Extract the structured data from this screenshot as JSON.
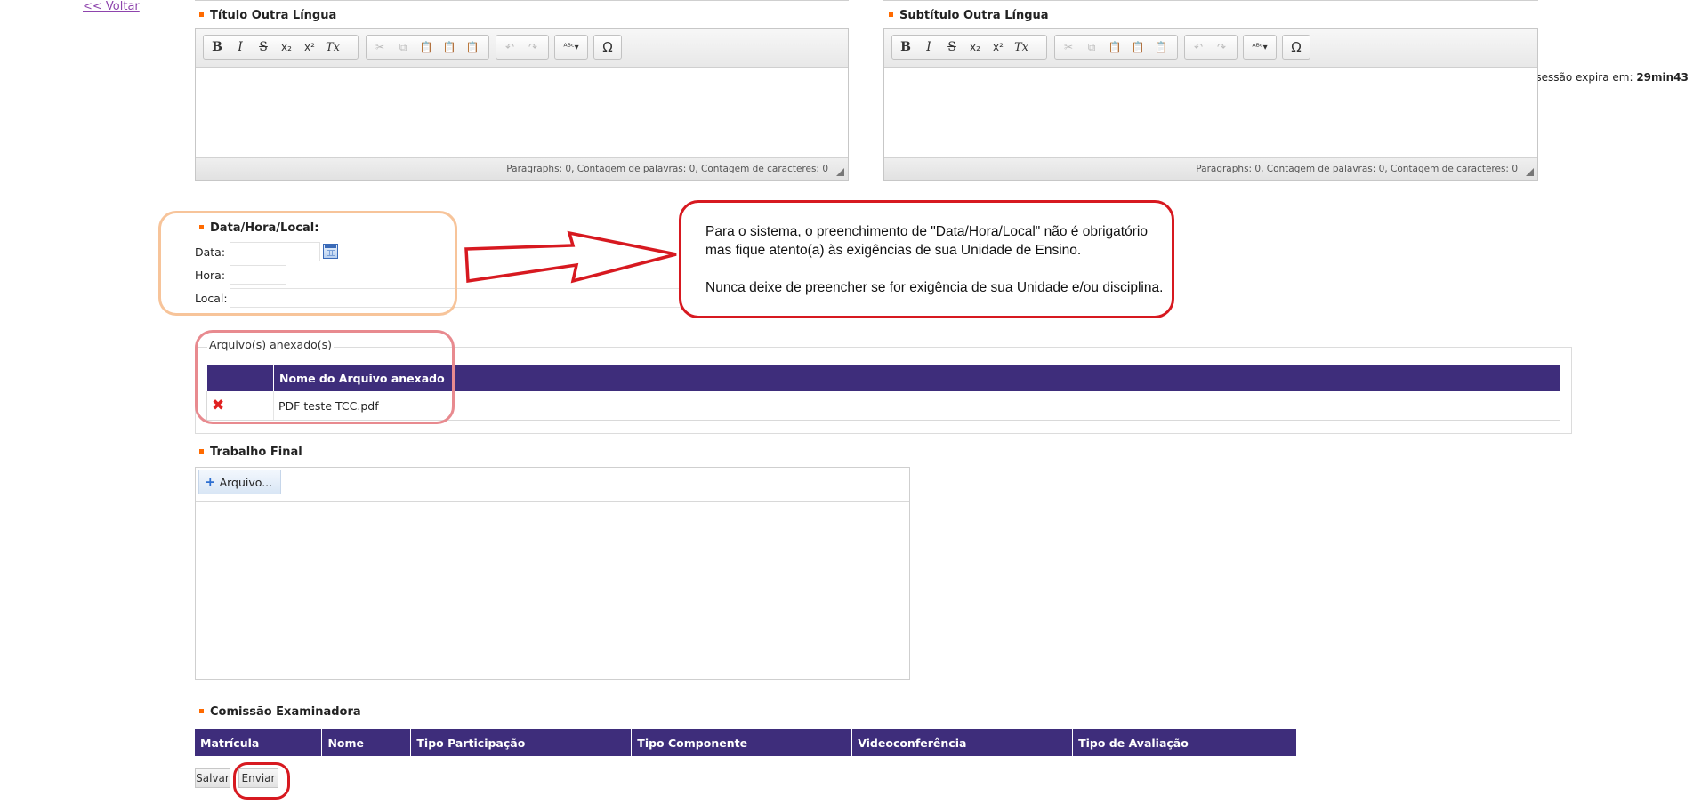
{
  "nav": {
    "back_link": "<< Voltar"
  },
  "session": {
    "label": "Sua sessão expira em:",
    "time": "29min43"
  },
  "editors": {
    "titulo": {
      "title": "Título Outra Língua",
      "status": "Paragraphs: 0, Contagem de palavras: 0, Contagem de caracteres: 0"
    },
    "subtitulo": {
      "title": "Subtítulo Outra Língua",
      "status": "Paragraphs: 0, Contagem de palavras: 0, Contagem de caracteres: 0"
    }
  },
  "toolbar_glyphs": {
    "bold": "B",
    "italic": "I",
    "strike": "S",
    "subscript": "x₂",
    "superscript": "x²",
    "remove_format": "Tx",
    "cut": "✂",
    "copy": "⧉",
    "paste": "📋",
    "paste_text": "📋",
    "paste_word": "📋",
    "undo": "↶",
    "redo": "↷",
    "spellcheck": "ᴬᴮᶜ▾",
    "special_char": "Ω"
  },
  "datahoralocal": {
    "title": "Data/Hora/Local:",
    "data_label": "Data:",
    "hora_label": "Hora:",
    "local_label": "Local:"
  },
  "callout": {
    "line1": "Para o sistema, o preenchimento de \"Data/Hora/Local\" não é obrigatório",
    "line2": "mas fique atento(a) às exigências de sua Unidade de Ensino.",
    "line3": "Nunca deixe de preencher se for exigência de sua Unidade e/ou disciplina."
  },
  "anexos": {
    "legend": "Arquivo(s) anexado(s)",
    "header": "Nome do Arquivo anexado",
    "rows": [
      {
        "name": "PDF teste TCC.pdf"
      }
    ],
    "delete_glyph": "✖"
  },
  "trabalho_final": {
    "title": "Trabalho Final",
    "choose_label": "Arquivo...",
    "plus": "+"
  },
  "comissao": {
    "title": "Comissão Examinadora",
    "columns": [
      "Matrícula",
      "Nome",
      "Tipo Participação",
      "Tipo Componente",
      "Videoconferência",
      "Tipo de Avaliação"
    ]
  },
  "buttons": {
    "salvar": "Salvar",
    "enviar": "Enviar"
  },
  "colors": {
    "header_purple": "#3e2d7b",
    "annotation_red": "#d71920",
    "annotation_orange": "#f7c49a",
    "annotation_pink": "#e88a8f",
    "bullet": "#ff6a00"
  }
}
